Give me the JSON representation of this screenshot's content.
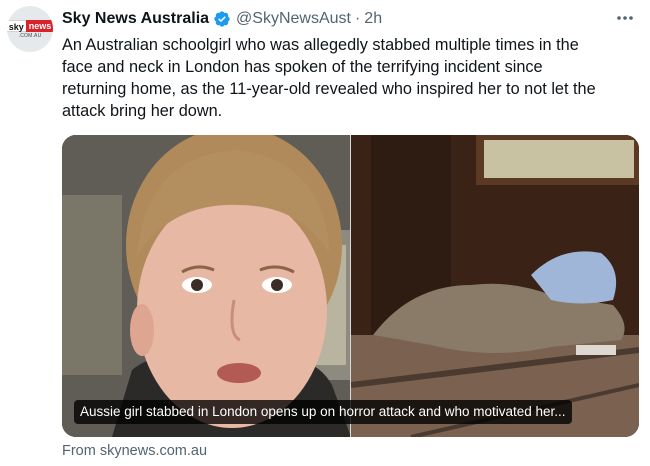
{
  "account": {
    "display_name": "Sky News Australia",
    "handle": "@SkyNewsAust",
    "separator": "·",
    "time": "2h",
    "verified": true,
    "avatar_logo": {
      "sky": "sky",
      "news": "news",
      "sub": ".COM.AU"
    }
  },
  "tweet": {
    "text": "An Australian schoolgirl who was allegedly stabbed multiple times in the\nface and neck in London has spoken of the terrifying incident since\nreturning home, as the 11-year-old revealed who inspired her to not let the\nattack bring her down."
  },
  "media": {
    "caption": "Aussie girl stabbed in London opens up on horror attack and who motivated her..."
  },
  "card": {
    "source": "From skynews.com.au"
  },
  "icons": {
    "verified": "verified-badge-icon",
    "more": "more-options-icon"
  },
  "colors": {
    "verified_blue": "#1d9bf0",
    "secondary_text": "#536471",
    "sky_news_red": "#d8232a"
  }
}
